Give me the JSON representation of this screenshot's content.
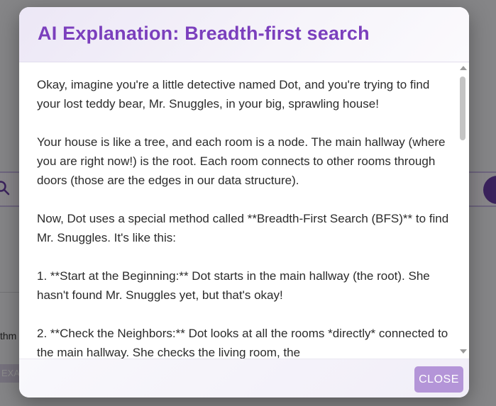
{
  "background": {
    "side_text": "thm",
    "chip_text": "EXA"
  },
  "modal": {
    "title": "AI Explanation: Breadth-first search",
    "paragraphs": [
      "Okay, imagine you're a little detective named Dot, and you're trying to find your lost teddy bear, Mr. Snuggles, in your big, sprawling house!",
      "Your house is like a tree, and each room is a node. The main hallway (where you are right now!) is the root. Each room connects to other rooms through doors (those are the edges in our data structure).",
      "Now, Dot uses a special method called **Breadth-First Search (BFS)** to find Mr. Snuggles.  It's like this:",
      "1. **Start at the Beginning:** Dot starts in the main hallway (the root). She hasn't found Mr. Snuggles yet, but that's okay!",
      "2. **Check the Neighbors:** Dot looks at all the rooms *directly* connected to the main hallway.  She checks the living room, the"
    ],
    "close_label": "CLOSE"
  },
  "colors": {
    "title": "#7b3fbd",
    "close_button": "#b495d8",
    "accent": "#6b3fa8"
  }
}
